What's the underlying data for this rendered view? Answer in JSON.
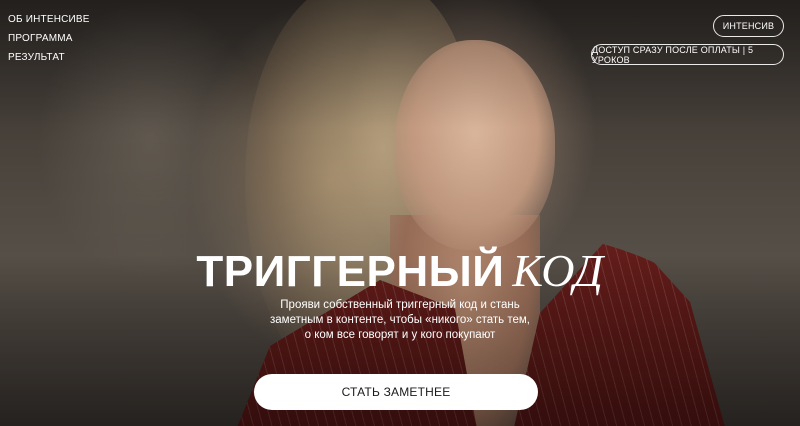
{
  "nav": {
    "items": [
      {
        "label": "ОБ ИНТЕНСИВЕ"
      },
      {
        "label": "ПРОГРАММА"
      },
      {
        "label": "РЕЗУЛЬТАТ"
      }
    ]
  },
  "header": {
    "intensive_label": "ИНТЕНСИВ",
    "access_label": "ДОСТУП СРАЗУ ПОСЛЕ ОПЛАТЫ | 5 УРОКОВ"
  },
  "hero": {
    "title_main": "ТРИГГЕРНЫЙ",
    "title_accent": "КОД",
    "subtitle_lines": [
      "Прояви собственный триггерный код и стань",
      "заметным в контенте, чтобы «никого» стать тем,",
      "о ком все говорят и у кого покупают"
    ],
    "cta_label": "СТАТЬ ЗАМЕТНЕЕ"
  },
  "colors": {
    "cta_background": "#ffffff",
    "jacket": "#6b1f1c"
  }
}
